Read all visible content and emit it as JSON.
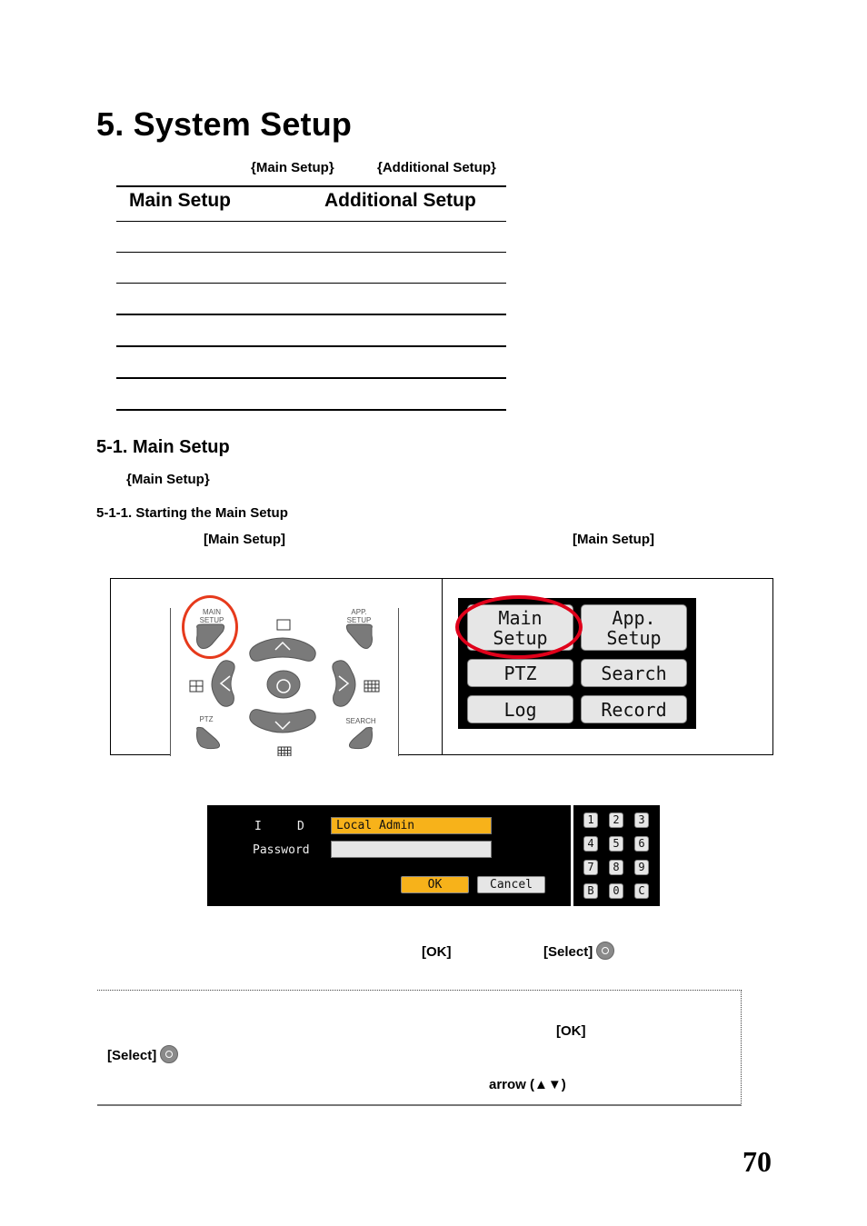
{
  "title": "5. System Setup",
  "intro": {
    "main_setup_ref": "{Main Setup}",
    "additional_setup_ref": "{Additional Setup}"
  },
  "overview_table": {
    "headers": [
      "Main Setup",
      "Additional Setup"
    ],
    "rows": [
      [
        "",
        ""
      ],
      [
        "",
        ""
      ],
      [
        "",
        ""
      ],
      [
        "",
        ""
      ],
      [
        "",
        ""
      ],
      [
        "",
        ""
      ]
    ]
  },
  "section": {
    "heading": "5-1. Main Setup",
    "body_ref": "{Main Setup}",
    "subheading": "5-1-1. Starting the Main Setup",
    "step_ref_1": "[Main Setup]",
    "step_ref_2": "[Main Setup]"
  },
  "remote": {
    "main_setup_label": "MAIN SETUP",
    "app_setup_label": "APP. SETUP",
    "ptz_label": "PTZ",
    "search_label": "SEARCH"
  },
  "lcd_menu": {
    "buttons": [
      "Main Setup",
      "App. Setup",
      "PTZ",
      "Search",
      "Log",
      "Record"
    ],
    "highlighted": "Main Setup"
  },
  "login_dialog": {
    "id_label": "I     D",
    "password_label": "Password",
    "id_value": "Local Admin",
    "password_value": "",
    "ok_label": "OK",
    "cancel_label": "Cancel",
    "accent_color": "#f7b21a",
    "keypad": [
      "1",
      "2",
      "3",
      "4",
      "5",
      "6",
      "7",
      "8",
      "9",
      "B",
      "0",
      "C"
    ]
  },
  "instruction": {
    "ok_ref": "[OK]",
    "select_ref": "[Select]",
    "select_icon": "select-button-icon"
  },
  "note": {
    "ok_ref": "[OK]",
    "select_ref": "[Select]",
    "arrow_ref": "arrow (▲▼)"
  },
  "page_number": "70"
}
